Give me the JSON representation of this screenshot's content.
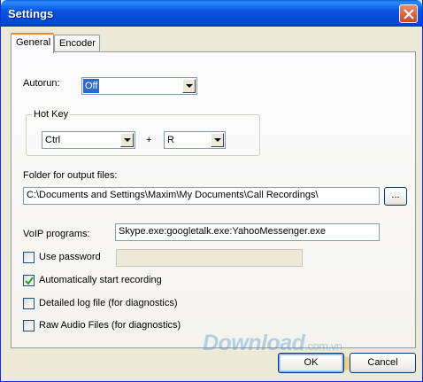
{
  "window": {
    "title": "Settings"
  },
  "tabs": [
    {
      "label": "General",
      "active": true
    },
    {
      "label": "Encoder",
      "active": false
    }
  ],
  "autorun": {
    "label": "Autorun:",
    "value": "Off"
  },
  "hotkey": {
    "group_label": "Hot Key",
    "modifier": "Ctrl",
    "plus": "+",
    "key": "R"
  },
  "output": {
    "label": "Folder for output files:",
    "value": "C:\\Documents and Settings\\Maxim\\My Documents\\Call Recordings\\",
    "browse_label": "..."
  },
  "voip": {
    "label": "VoIP programs:",
    "value": "Skype.exe:googletalk.exe:YahooMessenger.exe"
  },
  "checkboxes": [
    {
      "label": "Use password",
      "checked": false
    },
    {
      "label": "Automatically start recording",
      "checked": true
    },
    {
      "label": "Detailed log file (for diagnostics)",
      "checked": false
    },
    {
      "label": "Raw Audio Files (for diagnostics)",
      "checked": false
    }
  ],
  "buttons": {
    "ok": "OK",
    "cancel": "Cancel"
  },
  "watermark": {
    "text": "Download",
    "suffix": ".com.vn"
  },
  "colors": {
    "titlebar": "#0054e3",
    "window_bg": "#ece9d8",
    "selection": "#316ac5",
    "active_tab_accent": "#e68b2c"
  }
}
